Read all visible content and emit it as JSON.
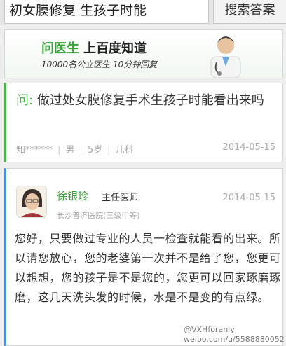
{
  "search": {
    "query": "初女膜修复 生孩子时能",
    "button_label": "搜索答案"
  },
  "banner": {
    "title_green": "问医生",
    "title_dark": "上百度知道",
    "subtitle": "10000名公立医生 10分钟回复"
  },
  "question": {
    "prefix": "问:",
    "text": "做过处女膜修复手术生孩子时能看出来吗",
    "user": "知******",
    "gender": "男",
    "age": "5岁",
    "department": "儿科",
    "date": "2014-05-15"
  },
  "answer": {
    "doctor_name": "徐银珍",
    "doctor_title": "主任医师",
    "hospital": "长沙普济医院(三级甲等)",
    "date": "2014-05-15",
    "text": "您好，只要做过专业的人员一检查就能看的出来。所以请您放心，您的老婆第一次并不是给了您，您更可以想想，您的孩子是不是您的，您更可以回家琢磨琢磨，这几天洗头发的时候，水是不是变的有点绿。"
  },
  "watermark": {
    "handle": "@VXHforanly",
    "url": "weibo.com/u/5588880052"
  },
  "colors": {
    "accent_green": "#48b548",
    "accent_blue": "#4a8fe0"
  }
}
